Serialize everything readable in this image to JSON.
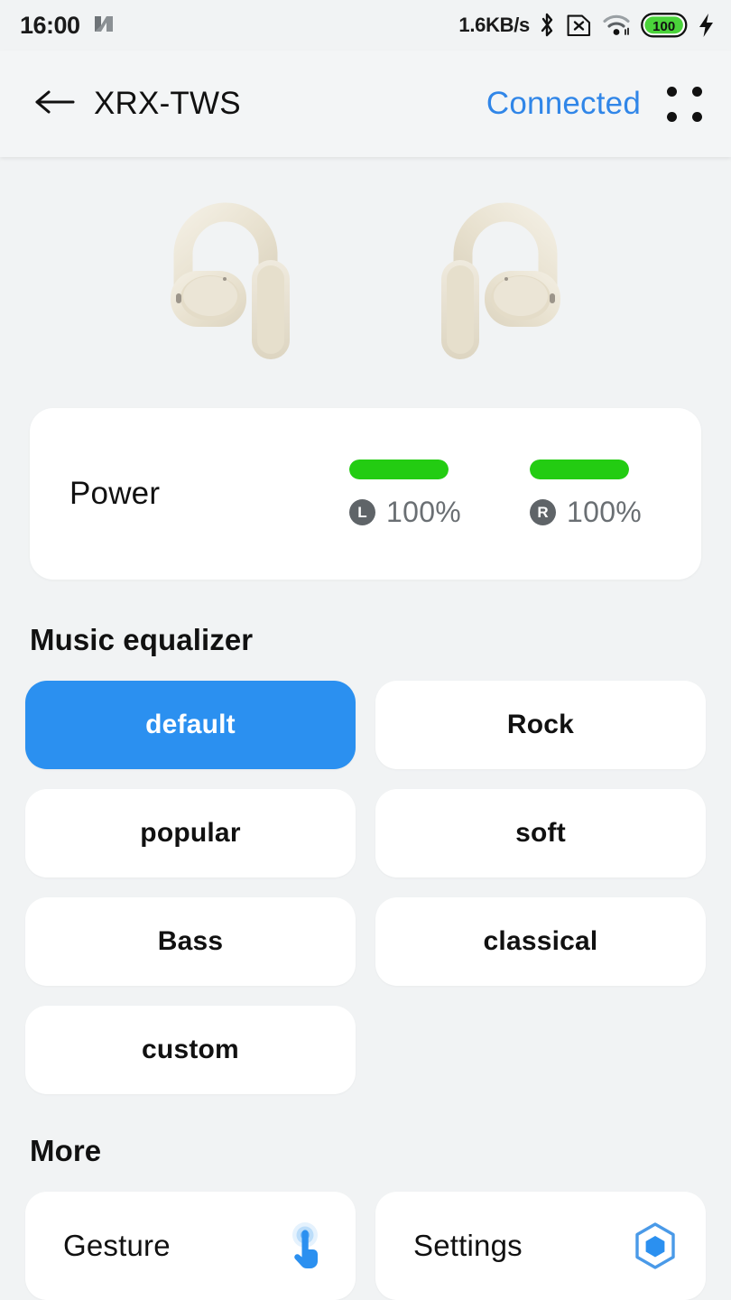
{
  "status_bar": {
    "time": "16:00",
    "nfc_icon": "nfc-icon",
    "network_speed": "1.6KB/s",
    "bluetooth_icon": "bluetooth-icon",
    "sim_icon": "no-sim-icon",
    "wifi_icon": "wifi-icon",
    "battery_level": "100",
    "battery_icon": "battery-icon",
    "charging_icon": "charging-bolt-icon"
  },
  "header": {
    "back_icon": "back-arrow-icon",
    "title": "XRX-TWS",
    "connection_status": "Connected",
    "menu_icon": "four-dots-menu-icon",
    "accent_color": "#3086e8"
  },
  "hero": {
    "left_earbud_icon": "left-earbud-image",
    "right_earbud_icon": "right-earbud-image",
    "earbud_color": "#ece6d8"
  },
  "power": {
    "label": "Power",
    "bar_color": "#23cc12",
    "buds": [
      {
        "side": "L",
        "badge": "L",
        "percent": "100%",
        "level": 100
      },
      {
        "side": "R",
        "badge": "R",
        "percent": "100%",
        "level": 100
      }
    ]
  },
  "equalizer": {
    "title": "Music equalizer",
    "selected": "default",
    "selected_color": "#2b90f0",
    "presets": [
      {
        "label": "default",
        "selected": true
      },
      {
        "label": "Rock",
        "selected": false
      },
      {
        "label": "popular",
        "selected": false
      },
      {
        "label": "soft",
        "selected": false
      },
      {
        "label": "Bass",
        "selected": false
      },
      {
        "label": "classical",
        "selected": false
      },
      {
        "label": "custom",
        "selected": false
      }
    ]
  },
  "more": {
    "title": "More",
    "items": [
      {
        "label": "Gesture",
        "icon": "tap-gesture-icon"
      },
      {
        "label": "Settings",
        "icon": "hexagon-settings-icon"
      }
    ]
  }
}
